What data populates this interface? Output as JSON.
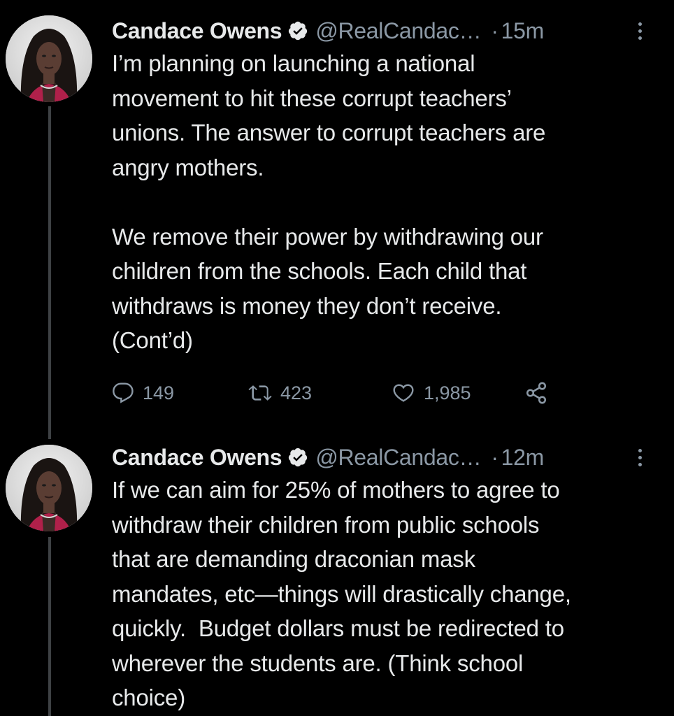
{
  "colors": {
    "background": "#000000",
    "text": "#e7e9ea",
    "muted": "#8b98a5",
    "thread_line": "#3e4144"
  },
  "tweets": [
    {
      "author_name": "Candace Owens",
      "handle": "@RealCandac…",
      "separator": "·",
      "time": "15m",
      "text": "I’m planning on launching a national\nmovement to hit these corrupt teachers’\nunions. The answer to corrupt teachers are\nangry mothers.\n\nWe remove their power by withdrawing our\nchildren from the schools. Each child that\nwithdraws is money they don’t receive.\n(Cont’d)",
      "replies": "149",
      "retweets": "423",
      "likes": "1,985"
    },
    {
      "author_name": "Candace Owens",
      "handle": "@RealCandac…",
      "separator": "·",
      "time": "12m",
      "text": "If we can aim for 25% of mothers to agree to\nwithdraw their children from public schools\nthat are demanding draconian mask\nmandates, etc—things will drastically change,\nquickly.  Budget dollars must be redirected to\nwherever the students are. (Think school\nchoice)"
    }
  ],
  "icons": {
    "verified": "verified-badge-icon",
    "more": "more-options-icon",
    "reply": "reply-icon",
    "retweet": "retweet-icon",
    "like": "like-icon",
    "share": "share-icon"
  }
}
